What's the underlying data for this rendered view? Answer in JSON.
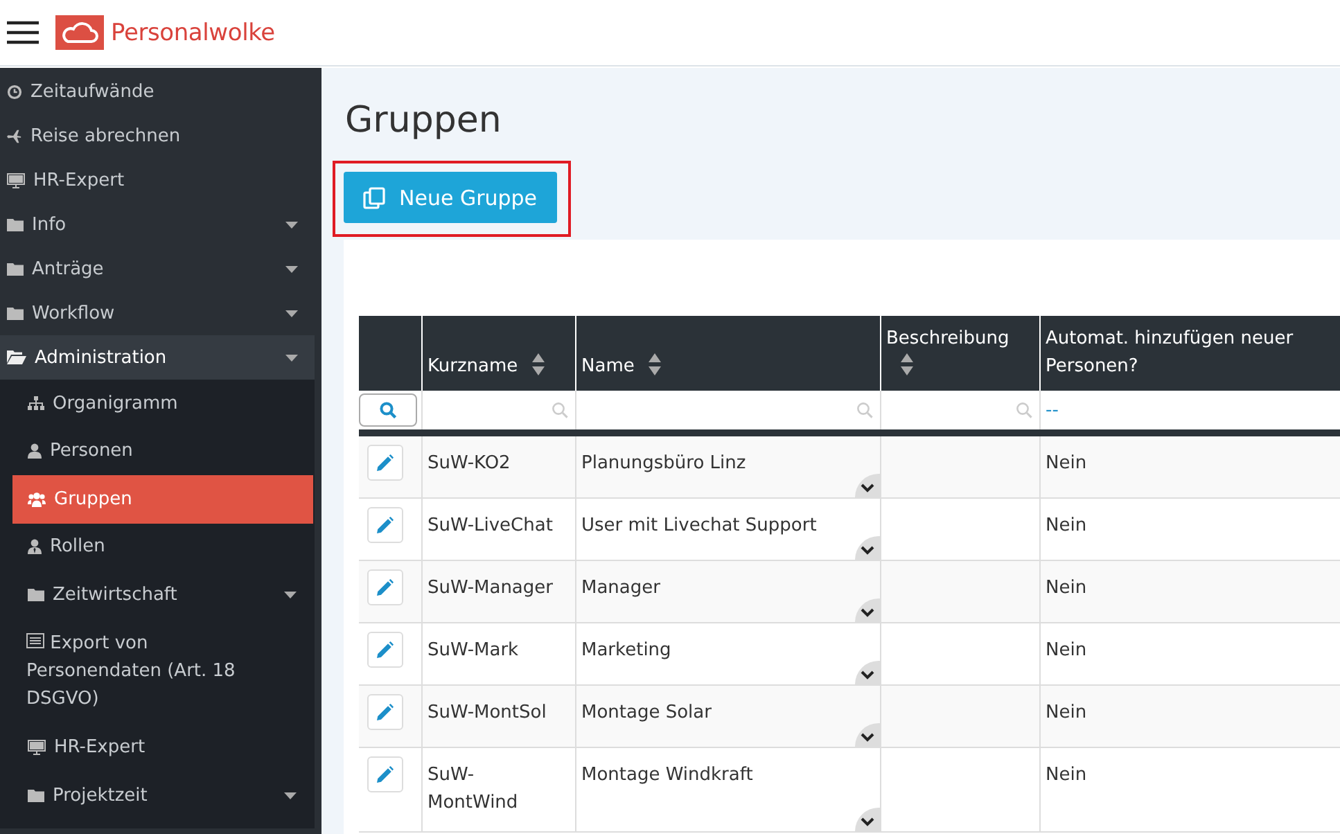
{
  "header": {
    "logo": "Personalwolke"
  },
  "sidebar": {
    "items": [
      {
        "label": "Zeitaufwände",
        "selected": false
      },
      {
        "label": "Reise abrechnen",
        "selected": false
      },
      {
        "label": "HR-Expert",
        "selected": false
      },
      {
        "label": "Info",
        "selected": false,
        "expanded": false
      },
      {
        "label": "Anträge",
        "selected": false,
        "expanded": false
      },
      {
        "label": "Workflow",
        "selected": false,
        "expanded": false
      },
      {
        "label": "Administration",
        "selected": false,
        "expanded": true,
        "children": [
          {
            "label": "Organigramm",
            "selected": false
          },
          {
            "label": "Personen",
            "selected": false
          },
          {
            "label": "Gruppen",
            "selected": true
          },
          {
            "label": "Rollen",
            "selected": false
          },
          {
            "label": "Zeitwirtschaft",
            "selected": false,
            "expanded": false
          },
          {
            "label": "Export von Personendaten (Art. 18 DSGVO)",
            "selected": false
          },
          {
            "label": "HR-Expert",
            "selected": false
          },
          {
            "label": "Projektzeit",
            "selected": false,
            "expanded": false
          }
        ]
      }
    ]
  },
  "page": {
    "title": "Gruppen",
    "new_button": {
      "label": "Neue Gruppe",
      "highlighted": true
    }
  },
  "table": {
    "columns": [
      {
        "label": "Kurzname",
        "sortable": true
      },
      {
        "label": "Name",
        "sortable": true
      },
      {
        "label": "Beschreibung",
        "sortable": true
      },
      {
        "label": "Automat. hinzufügen neuer Personen?",
        "sortable": false
      }
    ],
    "filter_value": "--",
    "rows": [
      {
        "short_name": "SuW-KO2",
        "name": "Planungsbüro Linz",
        "auto_add": "Nein"
      },
      {
        "short_name": "SuW-LiveChat",
        "name": "User mit Livechat Support",
        "auto_add": "Nein"
      },
      {
        "short_name": "SuW-Manager",
        "name": "Manager",
        "auto_add": "Nein"
      },
      {
        "short_name": "SuW-Mark",
        "name": "Marketing",
        "auto_add": "Nein"
      },
      {
        "short_name": "SuW-MontSol",
        "name": "Montage Solar",
        "auto_add": "Nein"
      },
      {
        "short_name": "SuW-MontWind",
        "name": "Montage Windkraft",
        "auto_add": "Nein"
      }
    ]
  }
}
